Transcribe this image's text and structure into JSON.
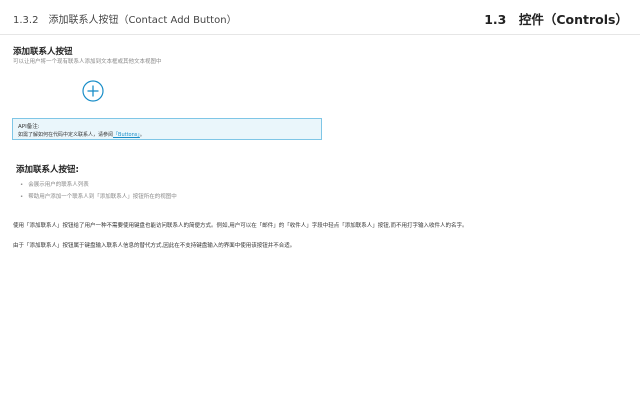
{
  "header": {
    "section": "1.3.2　添加联系人按钮（Contact Add Button）",
    "chapter": "1.3　控件（Controls）"
  },
  "item": {
    "title": "添加联系人按钮",
    "description": "可以让用户将一个现有联系人添加到文本框或其他文本视图中"
  },
  "note": {
    "label": "API备注:",
    "text_before": "如需了解如何在代码中定义联系人，请参阅",
    "link": "「Buttons」",
    "text_after": "。"
  },
  "usage": {
    "title": "添加联系人按钮:",
    "bullets": [
      "会展示用户的联系人列表",
      "帮助用户添加一个联系人到「添加联系人」按钮所在的视图中"
    ]
  },
  "paragraphs": [
    "使用「添加联系人」按钮给了用户一种不需要使用键盘也能访问联系人的简便方式。例如,用户可以在「邮件」的「收件人」字段中轻点「添加联系人」按钮,而不用打字输入收件人的名字。",
    "由于「添加联系人」按钮属于键盘输入联系人信息的替代方式,因此在不支持键盘输入的界面中使用该按钮并不合适。"
  ],
  "colors": {
    "accent": "#1a8ec8",
    "note_border": "#7fc6e6",
    "note_background": "#eaf6fb"
  },
  "icons": {
    "add_button": "plus-circle-icon"
  }
}
